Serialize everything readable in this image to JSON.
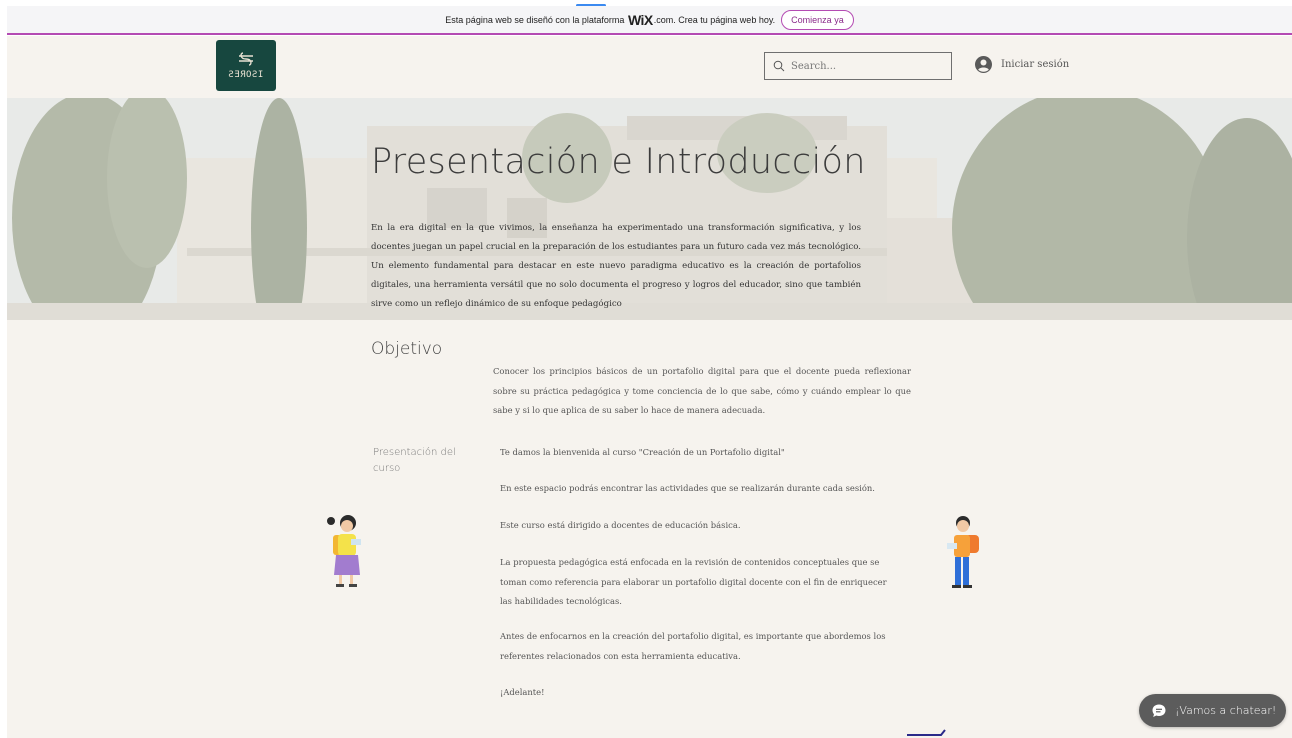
{
  "wix_banner": {
    "text_before": "Esta página web se diseñó con la plataforma",
    "brand": "WiX",
    "text_after": ".com. Crea tu página web hoy.",
    "cta_label": "Comienza ya"
  },
  "header": {
    "logo_text": "ƧƎЯOƧI",
    "search_placeholder": "Search...",
    "login_label": "Iniciar sesión"
  },
  "hero": {
    "title": "Presentación e Introducción",
    "text": "En la era digital en la que vivimos, la enseñanza ha experimentado una transformación significativa, y los docentes juegan un papel crucial en la preparación de los estudiantes para un futuro cada vez más tecnológico. Un elemento fundamental para destacar en este nuevo paradigma educativo es la creación de portafolios digitales, una herramienta versátil que no solo documenta el progreso y logros del educador, sino que también sirve como un reflejo dinámico de su enfoque pedagógico"
  },
  "objetivo": {
    "heading": "Objetivo",
    "text": "Conocer los principios básicos de un portafolio digital para que el docente pueda reflexionar sobre su práctica pedagógica y tome conciencia de lo que sabe, cómo y cuándo emplear lo que sabe y si lo que aplica de su saber lo hace de manera adecuada."
  },
  "curso": {
    "heading": "Presentación del curso",
    "paragraphs": [
      "Te damos la bienvenida al curso \"Creación de un Portafolio digital\"",
      "En este espacio podrás encontrar las actividades que se realizarán durante cada sesión.",
      "Este curso está dirigido a docentes de educación básica.",
      "La propuesta pedagógica está enfocada en la revisión de contenidos conceptuales que se toman como referencia para elaborar un portafolio digital docente con el fin de enriquecer las habilidades tecnológicas.",
      "Antes de enfocarnos en la creación del portafolio digital, es importante que abordemos los referentes relacionados con esta herramienta educativa.",
      "¡Adelante!"
    ]
  },
  "chat": {
    "label": "¡Vamos a chatear!"
  },
  "colors": {
    "banner_accent": "#b44bb3",
    "logo_bg": "#17473f",
    "page_bg": "#f6f3ee",
    "chat_bg": "#5c5c5c"
  }
}
